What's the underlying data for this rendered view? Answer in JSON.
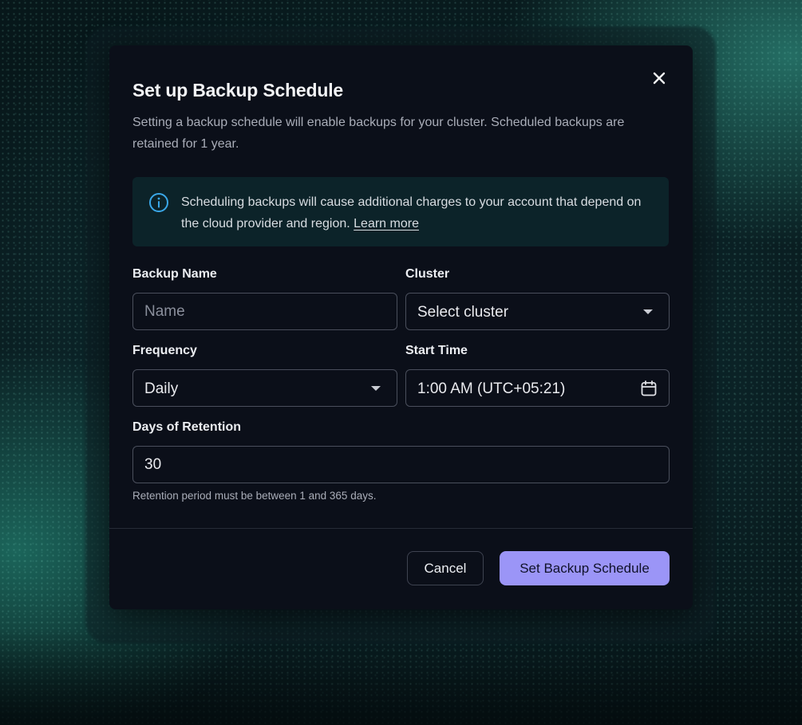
{
  "modal": {
    "title": "Set up Backup Schedule",
    "description": "Setting a backup schedule will enable backups for your cluster. Scheduled backups are retained for 1 year.",
    "info": {
      "text": "Scheduling backups will cause additional charges to your account that depend on the cloud provider and region.",
      "link": "Learn more",
      "icon": "info-circle-icon",
      "icon_color": "#3aa7e8"
    },
    "fields": {
      "backup_name": {
        "label": "Backup Name",
        "placeholder": "Name",
        "value": ""
      },
      "cluster": {
        "label": "Cluster",
        "selected": "Select cluster"
      },
      "frequency": {
        "label": "Frequency",
        "selected": "Daily"
      },
      "start_time": {
        "label": "Start Time",
        "value": "1:00 AM (UTC+05:21)",
        "icon": "calendar-icon"
      },
      "retention": {
        "label": "Days of Retention",
        "value": "30",
        "hint": "Retention period must be between 1 and 365 days."
      }
    },
    "buttons": {
      "cancel": "Cancel",
      "submit": "Set Backup Schedule"
    },
    "colors": {
      "modal_bg": "#0b0f19",
      "info_bg": "#0c2329",
      "primary": "#9b95f7"
    }
  }
}
